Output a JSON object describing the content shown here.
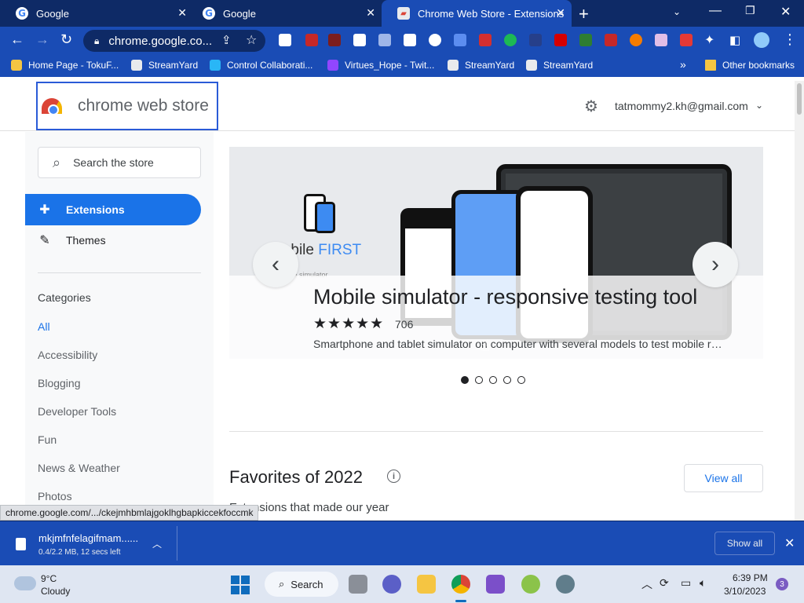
{
  "browser": {
    "tabs": [
      {
        "title": "Google"
      },
      {
        "title": "Google"
      },
      {
        "title": "Chrome Web Store - Extensions"
      }
    ],
    "url": "chrome.google.co...",
    "bookmarks": [
      "Home Page - TokuF...",
      "StreamYard",
      "Control Collaborati...",
      "Virtues_Hope - Twit...",
      "StreamYard",
      "StreamYard"
    ],
    "other_bookmarks": "Other bookmarks",
    "status_url": "chrome.google.com/.../ckejmhbmlajgoklhgbapkiccekfoccmk"
  },
  "store": {
    "logo_text": "chrome web store",
    "account": "tatmommy2.kh@gmail.com",
    "search_placeholder": "Search the store",
    "nav": [
      {
        "label": "Extensions"
      },
      {
        "label": "Themes"
      }
    ],
    "categories_title": "Categories",
    "categories": [
      "All",
      "Accessibility",
      "Blogging",
      "Developer Tools",
      "Fun",
      "News & Weather",
      "Photos"
    ],
    "banner": {
      "brand_a": "Mobile",
      "brand_b": "FIRST",
      "brand_sub": "mobile simulator",
      "title": "Mobile simulator - responsive testing tool",
      "rating": 5,
      "rating_count": "706",
      "description": "Smartphone and tablet simulator on computer with several models to test mobile responsiveness"
    },
    "carousel_count": 5,
    "carousel_active": 1,
    "section_title": "Favorites of 2022",
    "section_sub": "Extensions that made our year",
    "view_all": "View all"
  },
  "download": {
    "filename": "mkjmfnfelagifmam......",
    "progress": "0.4/2.2 MB, 12 secs left",
    "show_all": "Show all"
  },
  "taskbar": {
    "temp": "9°C",
    "condition": "Cloudy",
    "search": "Search",
    "time": "6:39 PM",
    "date": "3/10/2023",
    "notifications": "3"
  }
}
